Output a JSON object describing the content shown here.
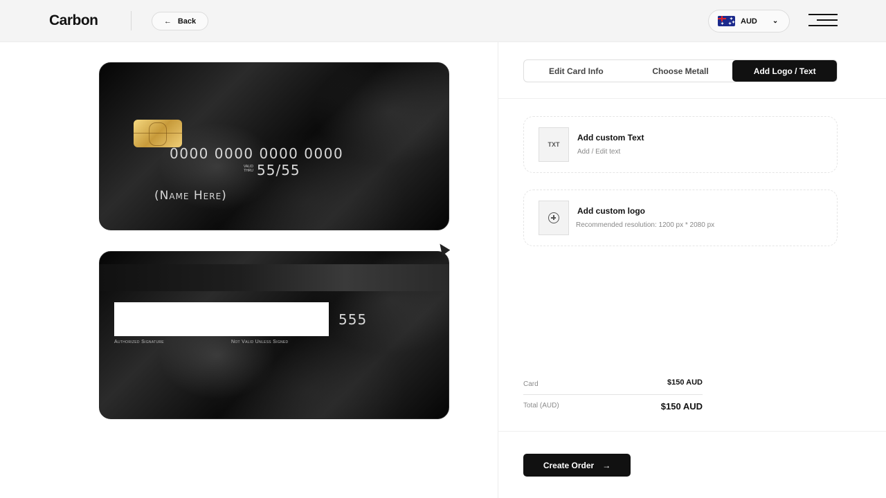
{
  "header": {
    "logo": "Carbon",
    "back_label": "Back",
    "back_arrow": "←",
    "currency": "AUD",
    "currency_chevron": "⌄"
  },
  "card_front": {
    "number": "0000 0000 0000 0000",
    "valid_thru_line1": "VALID",
    "valid_thru_line2": "THRU",
    "expiry": "55/55",
    "name": "(Name Here)"
  },
  "card_back": {
    "cvv": "555",
    "authorized_signature": "Authorized Signature",
    "not_valid": "Not Valid Unless Signed"
  },
  "tabs": [
    {
      "label": "Edit Card Info",
      "active": false
    },
    {
      "label": "Choose Metall",
      "active": false
    },
    {
      "label": "Add Logo / Text",
      "active": true
    }
  ],
  "options": {
    "text": {
      "icon_label": "TXT",
      "title": "Add custom Text",
      "subtitle": "Add / Edit text"
    },
    "logo": {
      "title": "Add custom logo",
      "subtitle": "Recommended resolution: 1200 px * 2080 px"
    }
  },
  "summary": {
    "card_label": "Card",
    "card_value": "$150 AUD",
    "total_label": "Total (AUD)",
    "total_value": "$150 AUD"
  },
  "actions": {
    "create_order": "Create Order",
    "create_arrow": "→"
  },
  "colors": {
    "accent": "#111111",
    "topbar_bg": "#f4f4f4"
  }
}
